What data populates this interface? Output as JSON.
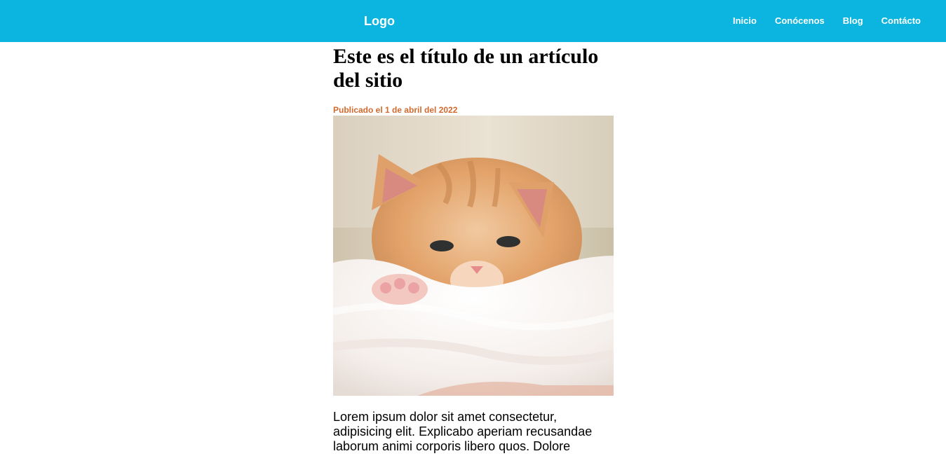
{
  "header": {
    "logo": "Logo",
    "nav": [
      "Inicio",
      "Conócenos",
      "Blog",
      "Contácto"
    ]
  },
  "article": {
    "title": "Este es el título de un artículo del sitio",
    "published": "Publicado el 1 de abril del 2022",
    "body": "Lorem ipsum dolor sit amet consectetur, adipisicing elit. Explicabo aperiam recusandae laborum animi corporis libero quos. Dolore"
  },
  "colors": {
    "header_bg": "#0bb5e0",
    "meta_text": "#d2692d"
  }
}
